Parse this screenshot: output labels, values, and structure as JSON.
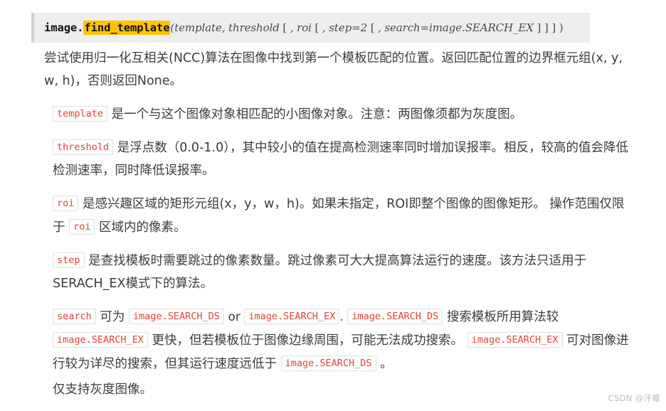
{
  "signature": {
    "owner": "image.",
    "name": "find_template",
    "open_paren": "(",
    "params_1": "template, threshold",
    "bracket_1": " [ ",
    "params_2": ", roi",
    "bracket_2": " [ ",
    "params_3": ", step=2",
    "bracket_3": " [ ",
    "params_4": ", search=image.SEARCH_EX",
    "closers": " ] ] ] )",
    "highlight_color": "#ffc400",
    "box_background": "#eeeeee"
  },
  "paragraphs": {
    "intro": "尝试使用归一化互相关(NCC)算法在图像中找到第一个模板匹配的位置。返回匹配位置的边界框元组(x, y, w, h)，否则返回None。",
    "template": {
      "code": "template",
      "text": "是一个与这个图像对象相匹配的小图像对象。注意：两图像须都为灰度图。"
    },
    "threshold": {
      "code": "threshold",
      "text": "是浮点数（0.0-1.0），其中较小的值在提高检测速率同时增加误报率。相反，较高的值会降低检测速率，同时降低误报率。"
    },
    "roi": {
      "code": "roi",
      "text_1": "是感兴趣区域的矩形元组(x，y，w，h)。如果未指定，ROI即整个图像的图像矩形。 操作范围仅限于",
      "code_2": "roi",
      "text_2": "区域内的像素。"
    },
    "step": {
      "code": "step",
      "text": "是查找模板时需要跳过的像素数量。跳过像素可大大提高算法运行的速度。该方法只适用于SERACH_EX模式下的算法。"
    },
    "search": {
      "code": "search",
      "text_1": "可为",
      "code_ds_1": "image.SEARCH_DS",
      "or_word": "or",
      "code_ex_1": "image.SEARCH_EX",
      "punct_period": ".",
      "code_ds_2": "image.SEARCH_DS",
      "text_2": "搜索模板所用算法较",
      "code_ex_2": "image.SEARCH_EX",
      "text_3": "更快，但若模板位于图像边缘周围，可能无法成功搜索。",
      "code_ex_3": "image.SEARCH_EX",
      "text_4": "可对图像进行较为详尽的搜索，但其运行速度远低于",
      "code_ds_3": "image.SEARCH_DS",
      "text_5": "。"
    },
    "footer": "仅支持灰度图像。"
  },
  "watermark": {
    "text": "CSDN @汗莓"
  },
  "colors": {
    "inline_code_text": "#e8433c",
    "body_text": "#3c3c3c",
    "watermark": "#b9b9b9"
  }
}
